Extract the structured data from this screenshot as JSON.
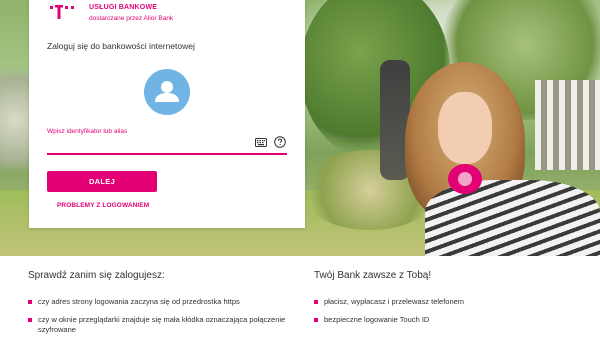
{
  "brand": {
    "logo_icon": "telekom-t-logo",
    "title": "USŁUGI BANKOWE",
    "subtitle": "dostarczane przez Alior Bank",
    "accent_color": "#e20074"
  },
  "login": {
    "heading": "Zaloguj się do bankowości internetowej",
    "avatar_icon": "user-avatar-icon",
    "field_label": "Wpisz identyfikator lub alias",
    "field_value": "",
    "keyboard_icon": "keyboard-icon",
    "help_icon": "help-circle-icon",
    "submit_label": "DALEJ",
    "problems_link": "PROBLEMY Z LOGOWANIEM"
  },
  "info": {
    "left": {
      "title": "Sprawdź zanim się zalogujesz:",
      "items": [
        "czy adres strony logowania zaczyna się od przedrostka https",
        "czy w oknie przeglądarki znajduje się mała kłódka oznaczająca połączenie szyfrowane"
      ]
    },
    "right": {
      "title": "Twój Bank zawsze z Tobą!",
      "items": [
        "płacisz, wypłacasz i przelewasz telefonem",
        "bezpieczne logowanie Touch ID"
      ]
    }
  }
}
